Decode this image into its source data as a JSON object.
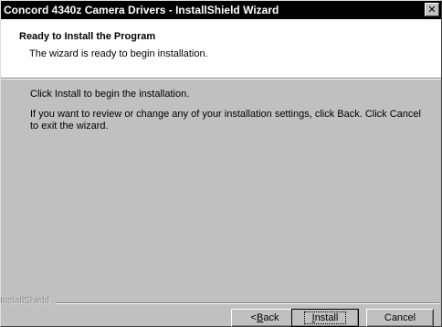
{
  "window": {
    "title": "Concord 4340z Camera Drivers - InstallShield Wizard",
    "close_glyph": "✕"
  },
  "header": {
    "title": "Ready to Install the Program",
    "subtitle": "The wizard is ready to begin installation."
  },
  "body": {
    "line1": "Click Install to begin the installation.",
    "line2": "If you want to review or change any of your installation settings, click Back. Click Cancel to exit the wizard."
  },
  "footer": {
    "brand": "InstallShield"
  },
  "buttons": {
    "back_prefix": "< ",
    "back_access": "B",
    "back_rest": "ack",
    "install_access": "I",
    "install_rest": "nstall",
    "cancel": "Cancel"
  },
  "colors": {
    "titlebar": "#000000",
    "dialog_bg": "#c0c0c0",
    "header_bg": "#ffffff"
  },
  "icons": {
    "close": "close-icon"
  }
}
